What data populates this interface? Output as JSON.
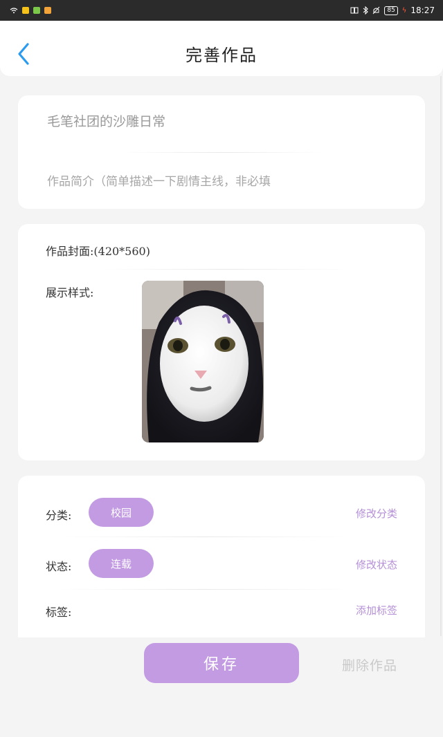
{
  "status_bar": {
    "time": "18:27",
    "battery": "85",
    "left_icons": [
      "wifi-icon",
      "app-icon-1",
      "app-icon-2",
      "app-icon-3"
    ],
    "right_icons": [
      "book-icon",
      "bluetooth-icon",
      "mute-icon",
      "battery-icon"
    ]
  },
  "header": {
    "title": "完善作品",
    "back_icon": "chevron-left-icon",
    "accent": "#2b9bf0"
  },
  "work_info": {
    "title_value": "毛笔社团的沙雕日常",
    "intro_placeholder": "作品简介（简单描述一下剧情主线，非必填"
  },
  "cover": {
    "cover_label": "作品封面:(420*560)",
    "display_label": "展示样式:"
  },
  "meta": {
    "category_label": "分类:",
    "category_value": "校园",
    "category_action": "修改分类",
    "status_label": "状态:",
    "status_value": "连载",
    "status_action": "修改状态",
    "tags_label": "标签:",
    "tags_action": "添加标签"
  },
  "actions": {
    "save_label": "保存",
    "delete_label": "删除作品"
  },
  "colors": {
    "primary": "#c39be3",
    "link": "#b48fd6",
    "page_bg": "#f4f4f5"
  }
}
